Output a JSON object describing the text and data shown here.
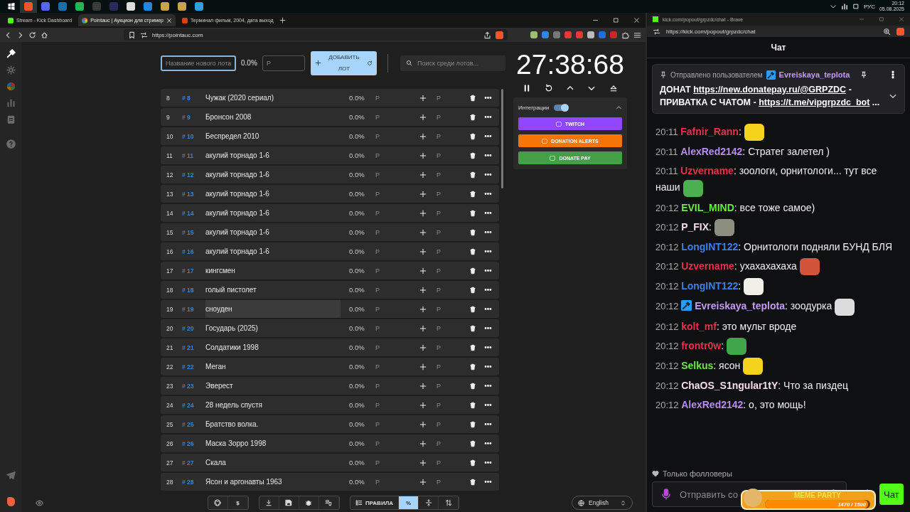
{
  "taskbar": {
    "apps": [
      {
        "kind": "windows",
        "selected": false
      },
      {
        "kind": "brave",
        "selected": true
      },
      {
        "kind": "discord",
        "selected": false
      },
      {
        "kind": "steam",
        "selected": false
      },
      {
        "kind": "spotify",
        "selected": false
      },
      {
        "kind": "obs",
        "selected": false
      },
      {
        "kind": "disc",
        "selected": false
      },
      {
        "kind": "block",
        "selected": false
      },
      {
        "kind": "arrow",
        "selected": false
      },
      {
        "kind": "game",
        "selected": false
      },
      {
        "kind": "game",
        "selected": false
      },
      {
        "kind": "telegram",
        "selected": false
      }
    ],
    "tray": {
      "language": "РУС",
      "time": "20:12",
      "date": "05.08.2025"
    }
  },
  "browser": {
    "tabs": [
      {
        "title": "Stream - Kick Dashboard",
        "selected": false
      },
      {
        "title": "Pointauc | Аукцион для стример",
        "selected": true
      },
      {
        "title": "Терминал фильм, 2004, дата выход",
        "selected": false
      }
    ],
    "url": "https://pointauc.com"
  },
  "sidebar": {
    "items": [
      {
        "kind": "gavel",
        "selected": true
      },
      {
        "kind": "gear",
        "selected": false
      },
      {
        "kind": "pie",
        "selected": false
      },
      {
        "kind": "bars",
        "selected": false
      },
      {
        "kind": "clipboard",
        "selected": false
      },
      {
        "kind": "help",
        "selected": false
      }
    ]
  },
  "auction": {
    "new_lot": {
      "placeholder": "Название нового лота"
    },
    "percent": "0.0%",
    "amount": {
      "placeholder": "Р"
    },
    "add_button": "ДОБАВИТЬ ЛОТ",
    "search": {
      "placeholder": "Поиск среди лотов..."
    },
    "lots": [
      {
        "index": "8",
        "tag": "# 8",
        "name": "Чужак (2020 сериал)",
        "percent": "0.0%",
        "amount": "Р",
        "add": "Р",
        "highlighted": false
      },
      {
        "index": "9",
        "tag": "# 9",
        "name": "Бронсон 2008",
        "percent": "0.0%",
        "amount": "Р",
        "add": "Р",
        "highlighted": false
      },
      {
        "index": "10",
        "tag": "# 10",
        "name": "Беспредел 2010",
        "percent": "0.0%",
        "amount": "Р",
        "add": "Р",
        "highlighted": false
      },
      {
        "index": "11",
        "tag": "# 11",
        "name": "акулий торнадо 1-6",
        "percent": "0.0%",
        "amount": "Р",
        "add": "Р",
        "highlighted": false
      },
      {
        "index": "12",
        "tag": "# 12",
        "name": "акулий торнадо 1-6",
        "percent": "0.0%",
        "amount": "Р",
        "add": "Р",
        "highlighted": false
      },
      {
        "index": "13",
        "tag": "# 13",
        "name": "акулий торнадо 1-6",
        "percent": "0.0%",
        "amount": "Р",
        "add": "Р",
        "highlighted": false
      },
      {
        "index": "14",
        "tag": "# 14",
        "name": "акулий торнадо 1-6",
        "percent": "0.0%",
        "amount": "Р",
        "add": "Р",
        "highlighted": false
      },
      {
        "index": "15",
        "tag": "# 15",
        "name": "акулий торнадо 1-6",
        "percent": "0.0%",
        "amount": "Р",
        "add": "Р",
        "highlighted": false
      },
      {
        "index": "16",
        "tag": "# 16",
        "name": "акулий торнадо 1-6",
        "percent": "0.0%",
        "amount": "Р",
        "add": "Р",
        "highlighted": false
      },
      {
        "index": "17",
        "tag": "# 17",
        "name": "кингсмен",
        "percent": "0.0%",
        "amount": "Р",
        "add": "Р",
        "highlighted": false
      },
      {
        "index": "18",
        "tag": "# 18",
        "name": "голый пистолет",
        "percent": "0.0%",
        "amount": "Р",
        "add": "Р",
        "highlighted": false
      },
      {
        "index": "19",
        "tag": "# 19",
        "name": "сноуден",
        "percent": "0.0%",
        "amount": "Р",
        "add": "Р",
        "highlighted": true
      },
      {
        "index": "20",
        "tag": "# 20",
        "name": "Государь (2025)",
        "percent": "0.0%",
        "amount": "Р",
        "add": "Р",
        "highlighted": false
      },
      {
        "index": "21",
        "tag": "# 21",
        "name": "Солдатики 1998",
        "percent": "0.0%",
        "amount": "Р",
        "add": "Р",
        "highlighted": false
      },
      {
        "index": "22",
        "tag": "# 22",
        "name": "Меган",
        "percent": "0.0%",
        "amount": "Р",
        "add": "Р",
        "highlighted": false
      },
      {
        "index": "23",
        "tag": "# 23",
        "name": "Эверест",
        "percent": "0.0%",
        "amount": "Р",
        "add": "Р",
        "highlighted": false
      },
      {
        "index": "24",
        "tag": "# 24",
        "name": "28 недель спустя",
        "percent": "0.0%",
        "amount": "Р",
        "add": "Р",
        "highlighted": false
      },
      {
        "index": "25",
        "tag": "# 25",
        "name": "Братство волка.",
        "percent": "0.0%",
        "amount": "Р",
        "add": "Р",
        "highlighted": false
      },
      {
        "index": "26",
        "tag": "# 26",
        "name": "Маска Зорро 1998",
        "percent": "0.0%",
        "amount": "Р",
        "add": "Р",
        "highlighted": false
      },
      {
        "index": "27",
        "tag": "# 27",
        "name": "Скала",
        "percent": "0.0%",
        "amount": "Р",
        "add": "Р",
        "highlighted": false
      },
      {
        "index": "28",
        "tag": "# 28",
        "name": "Ясон и аргонавты 1963",
        "percent": "0.0%",
        "amount": "Р",
        "add": "Р",
        "highlighted": false
      }
    ]
  },
  "timer": {
    "time": "27:38:68"
  },
  "integrations": {
    "label": "Интеграции",
    "enabled": true,
    "expanded": true,
    "buttons": [
      {
        "label": "TWITCH",
        "color": "#9147ff"
      },
      {
        "label": "DONATION ALERTS",
        "color": "#f57507"
      },
      {
        "label": "DONATE PAY",
        "color": "#43a047"
      }
    ]
  },
  "bottom_bar": {
    "groups": [
      [
        {
          "kind": "github",
          "selected": false
        },
        {
          "kind": "dollar",
          "label": "$",
          "selected": false
        }
      ],
      [
        {
          "kind": "download",
          "selected": false
        },
        {
          "kind": "save",
          "selected": false
        },
        {
          "kind": "bug",
          "selected": false
        },
        {
          "kind": "clear",
          "selected": false
        }
      ],
      [
        {
          "kind": "rules",
          "label": "ПРАВИЛА",
          "selected": false
        },
        {
          "kind": "percent",
          "label": "%",
          "selected": true
        },
        {
          "kind": "split",
          "selected": false
        },
        {
          "kind": "sort",
          "selected": false
        }
      ]
    ],
    "language": "English"
  },
  "chat_window": {
    "title": "kick.com/popout/grpzdc/chat - Brave",
    "url": "https://kick.com/popout/grpzdc/chat"
  },
  "chat": {
    "title": "Чат",
    "pinned": {
      "label": "Отправлено пользователем",
      "user": "Evreiskaya_teplota",
      "parts": [
        {
          "kind": "text",
          "text": "ДОНАТ "
        },
        {
          "kind": "link",
          "text": "https://new.donatepay.ru/@GRPZDC"
        },
        {
          "kind": "text",
          "text": " - ПРИВАТКА С ЧАТОМ - "
        },
        {
          "kind": "link",
          "text": "https://t.me/vipgrpzdc_bot"
        },
        {
          "kind": "text",
          "text": " ..."
        }
      ]
    },
    "messages": [
      {
        "time": "20:11",
        "badge": false,
        "user": "Fafnir_Rann",
        "color": "#e8304c",
        "text": ":",
        "emote": true
      },
      {
        "time": "20:11",
        "badge": false,
        "user": "AlexRed2142",
        "color": "#b78cf2",
        "text": ": Стратег залетел )",
        "emote": false
      },
      {
        "time": "20:11",
        "badge": false,
        "user": "Uzvername",
        "color": "#e8304c",
        "text": ": зоологи, орнитологи... тут все наши",
        "emote": true
      },
      {
        "time": "20:12",
        "badge": false,
        "user": "EVIL_MIND",
        "color": "#6ee84a",
        "text": ": все тоже самое)",
        "emote": false
      },
      {
        "time": "20:12",
        "badge": false,
        "user": "P_FIX",
        "color": "#f4dde6",
        "text": ":",
        "emote": true
      },
      {
        "time": "20:12",
        "badge": false,
        "user": "LongINT122",
        "color": "#3d80e6",
        "text": ": Орнитологи подняли БУНД БЛЯ",
        "emote": false
      },
      {
        "time": "20:12",
        "badge": false,
        "user": "Uzvername",
        "color": "#e8304c",
        "text": ": ухахахахаха",
        "emote": true
      },
      {
        "time": "20:12",
        "badge": false,
        "user": "LongINT122",
        "color": "#3d80e6",
        "text": ":",
        "emote": true
      },
      {
        "time": "20:12",
        "badge": true,
        "user": "Evreiskaya_teplota",
        "color": "#c39cf5",
        "text": ": зоодурка",
        "emote": true
      },
      {
        "time": "20:12",
        "badge": false,
        "user": "kolt_mf",
        "color": "#e8304c",
        "text": ": это мульт вроде",
        "emote": false
      },
      {
        "time": "20:12",
        "badge": false,
        "user": "frontr0w",
        "color": "#e8304c",
        "text": ":",
        "emote": true
      },
      {
        "time": "20:12",
        "badge": false,
        "user": "Selkus",
        "color": "#6ee84a",
        "text": ": ясон",
        "emote": true
      },
      {
        "time": "20:12",
        "badge": false,
        "user": "ChaOS_S1ngular1tY",
        "color": "#f4dde6",
        "text": ": Что за пиздец",
        "emote": false
      },
      {
        "time": "20:12",
        "badge": false,
        "user": "AlexRed2142",
        "color": "#b78cf2",
        "text": ": о, это мощь!",
        "emote": false
      }
    ],
    "mode": "Только фолловеры",
    "input": {
      "placeholder": "Отправить со"
    },
    "send_button": "Чат",
    "meme_party": {
      "title": "MEME PARTY",
      "count": "1470 / 1500",
      "level": 0.98
    }
  }
}
